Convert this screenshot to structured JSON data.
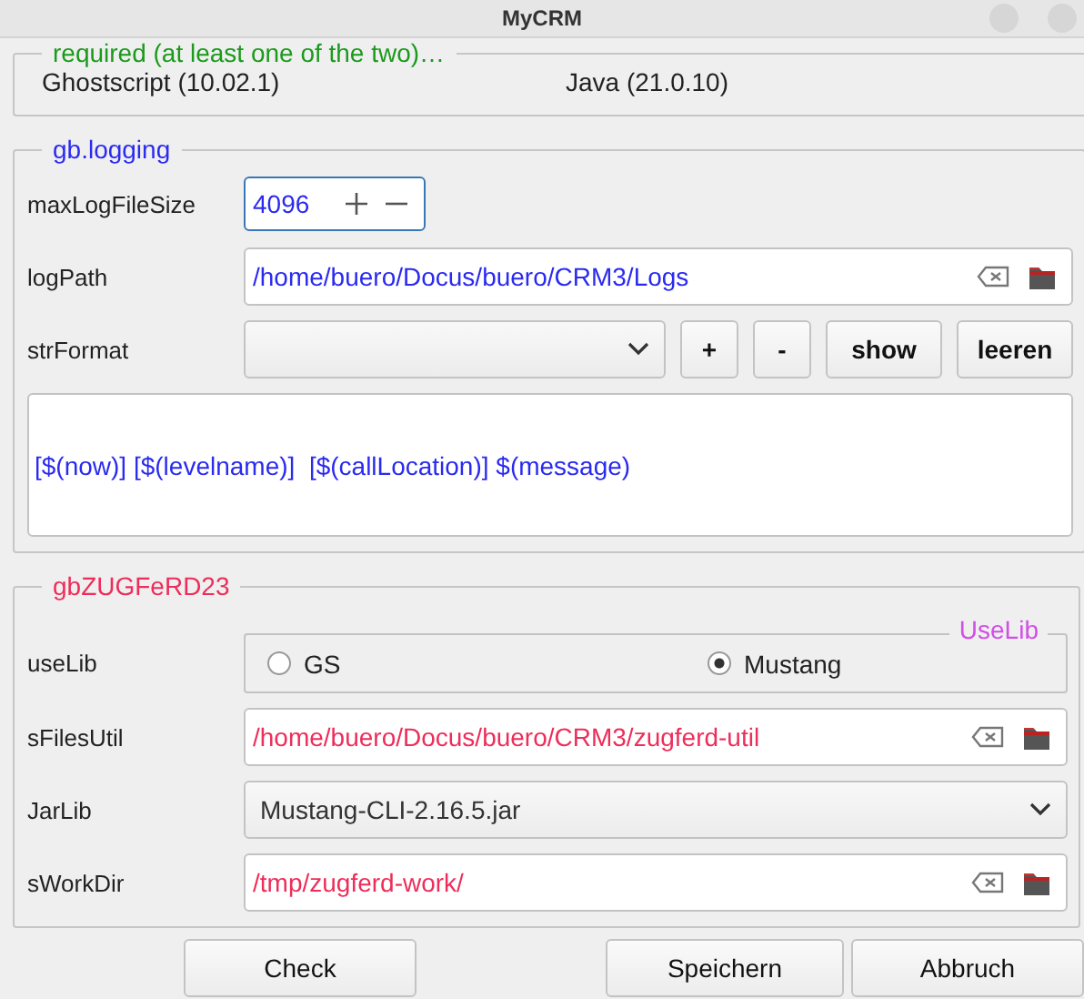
{
  "window": {
    "title": "MyCRM"
  },
  "groups": [
    {
      "kind": "info",
      "title": "required (at least one of the two)…",
      "color": "#1c9a1c",
      "items": [
        "Ghostscript (10.02.1)",
        "Java (21.0.10)"
      ]
    },
    {
      "kind": "form",
      "title": "gb.logging",
      "color": "#2a2af0",
      "rows": [
        {
          "kind": "spinbox",
          "label": "maxLogFileSize",
          "value": "4096"
        },
        {
          "kind": "path",
          "label": "logPath",
          "value": "/home/buero/Docus/buero/CRM3/Logs"
        },
        {
          "kind": "combo_buttons",
          "label": "strFormat",
          "buttons": [
            "+",
            "-",
            "show",
            "leeren"
          ]
        },
        {
          "kind": "textarea",
          "value": "[$(now)] [$(levelname)]  [$(callLocation)] $(message)"
        }
      ]
    },
    {
      "kind": "form",
      "title": "gbZUGFeRD23",
      "color": "#ee2d5a",
      "rows": [
        {
          "kind": "radio",
          "label": "useLib",
          "title": "UseLib",
          "options": [
            {
              "label": "GS",
              "selected": false
            },
            {
              "label": "Mustang",
              "selected": true
            }
          ]
        },
        {
          "kind": "path",
          "label": "sFilesUtil",
          "value": "/home/buero/Docus/buero/CRM3/zugferd-util"
        },
        {
          "kind": "combo",
          "label": "JarLib",
          "value": "Mustang-CLI-2.16.5.jar"
        },
        {
          "kind": "path",
          "label": "sWorkDir",
          "value": "/tmp/zugferd-work/"
        }
      ]
    }
  ],
  "buttons": [
    "Check",
    "Speichern",
    "Abbruch"
  ]
}
